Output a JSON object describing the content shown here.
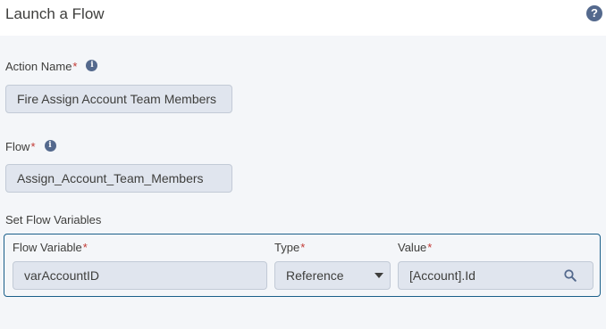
{
  "header": {
    "title": "Launch a Flow",
    "help_icon": "question-circle-icon",
    "help_glyph": "?"
  },
  "action_name": {
    "label": "Action Name",
    "required": "*",
    "info_glyph": "i",
    "value": "Fire Assign Account Team Members"
  },
  "flow": {
    "label": "Flow",
    "required": "*",
    "info_glyph": "i",
    "value": "Assign_Account_Team_Members"
  },
  "flow_variables": {
    "section_label": "Set Flow Variables",
    "columns": [
      {
        "label": "Flow Variable",
        "required": "*"
      },
      {
        "label": "Type",
        "required": "*"
      },
      {
        "label": "Value",
        "required": "*"
      }
    ],
    "rows": [
      {
        "variable": "varAccountID",
        "type": "Reference",
        "value": "[Account].Id"
      }
    ]
  },
  "colors": {
    "accent_border": "#1b5f8a",
    "required": "#c23934",
    "icon": "#54698d"
  }
}
